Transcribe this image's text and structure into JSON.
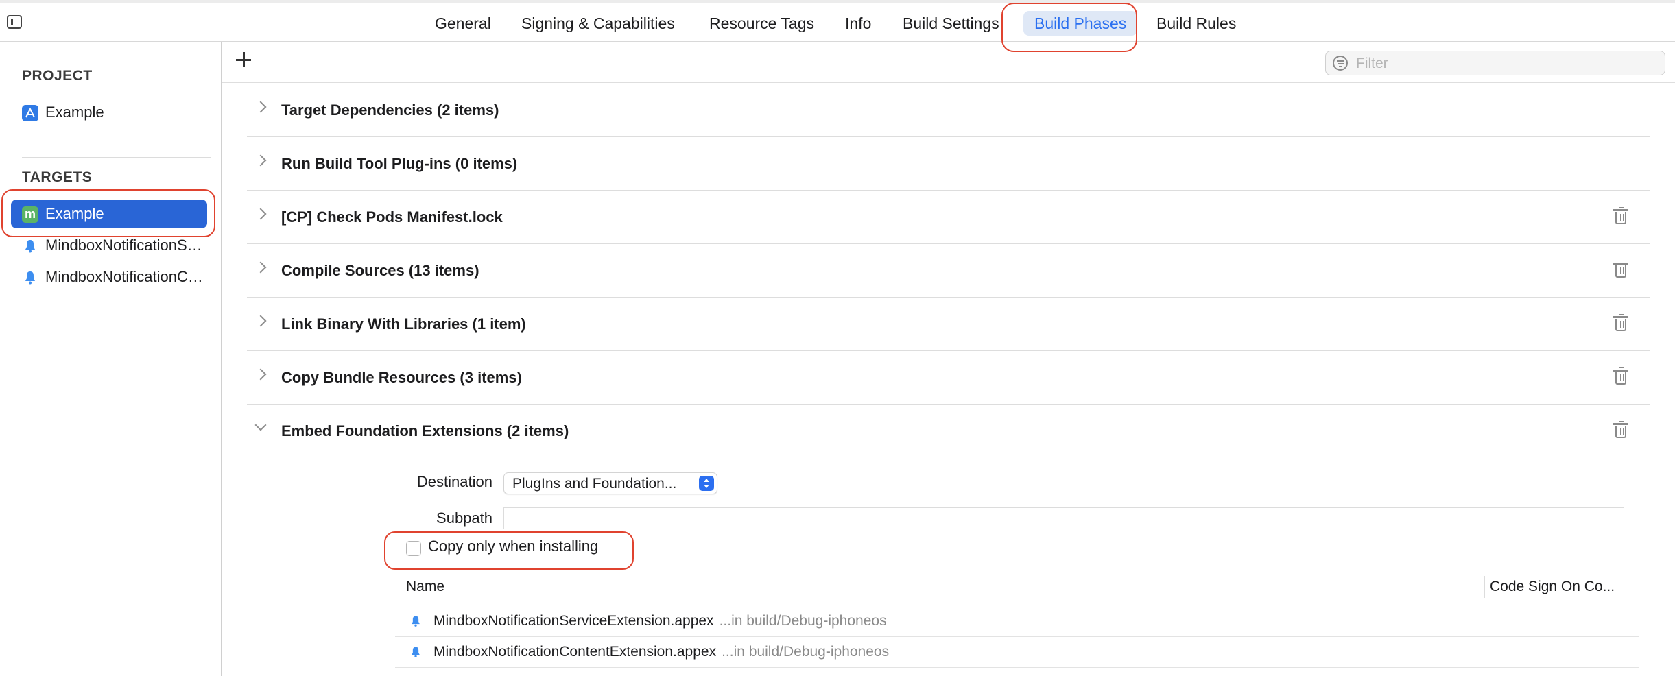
{
  "tabs": [
    {
      "label": "General"
    },
    {
      "label": "Signing & Capabilities"
    },
    {
      "label": "Resource Tags"
    },
    {
      "label": "Info"
    },
    {
      "label": "Build Settings"
    },
    {
      "label": "Build Phases",
      "selected": true
    },
    {
      "label": "Build Rules"
    }
  ],
  "sidebar": {
    "project_header": "PROJECT",
    "project_item": "Example",
    "targets_header": "TARGETS",
    "targets": [
      {
        "label": "Example",
        "icon": "app-target-icon",
        "selected": true
      },
      {
        "label": "MindboxNotificationServiceExtension",
        "icon": "bell-icon"
      },
      {
        "label": "MindboxNotificationContentExtension",
        "icon": "bell-icon"
      }
    ]
  },
  "toolbar": {
    "filter_placeholder": "Filter"
  },
  "phases": [
    {
      "title": "Target Dependencies (2 items)",
      "deletable": false
    },
    {
      "title": "Run Build Tool Plug-ins (0 items)",
      "deletable": false
    },
    {
      "title": "[CP] Check Pods Manifest.lock",
      "deletable": true
    },
    {
      "title": "Compile Sources (13 items)",
      "deletable": true
    },
    {
      "title": "Link Binary With Libraries (1 item)",
      "deletable": true
    },
    {
      "title": "Copy Bundle Resources (3 items)",
      "deletable": true
    },
    {
      "title": "Embed Foundation Extensions (2 items)",
      "deletable": true,
      "expanded": true
    }
  ],
  "embed": {
    "destination_label": "Destination",
    "destination_value": "PlugIns and Foundation...",
    "subpath_label": "Subpath",
    "subpath_value": "",
    "copy_only_label": "Copy only when installing",
    "copy_only_checked": false,
    "table": {
      "col_name": "Name",
      "col_code_sign": "Code Sign On Co...",
      "rows": [
        {
          "name": "MindboxNotificationServiceExtension.appex",
          "path": "...in build/Debug-iphoneos"
        },
        {
          "name": "MindboxNotificationContentExtension.appex",
          "path": "...in build/Debug-iphoneos"
        }
      ]
    }
  },
  "colors": {
    "accent": "#2965d6",
    "highlight": "#e0432f",
    "selected_tab_bg": "#dfe8f6"
  }
}
